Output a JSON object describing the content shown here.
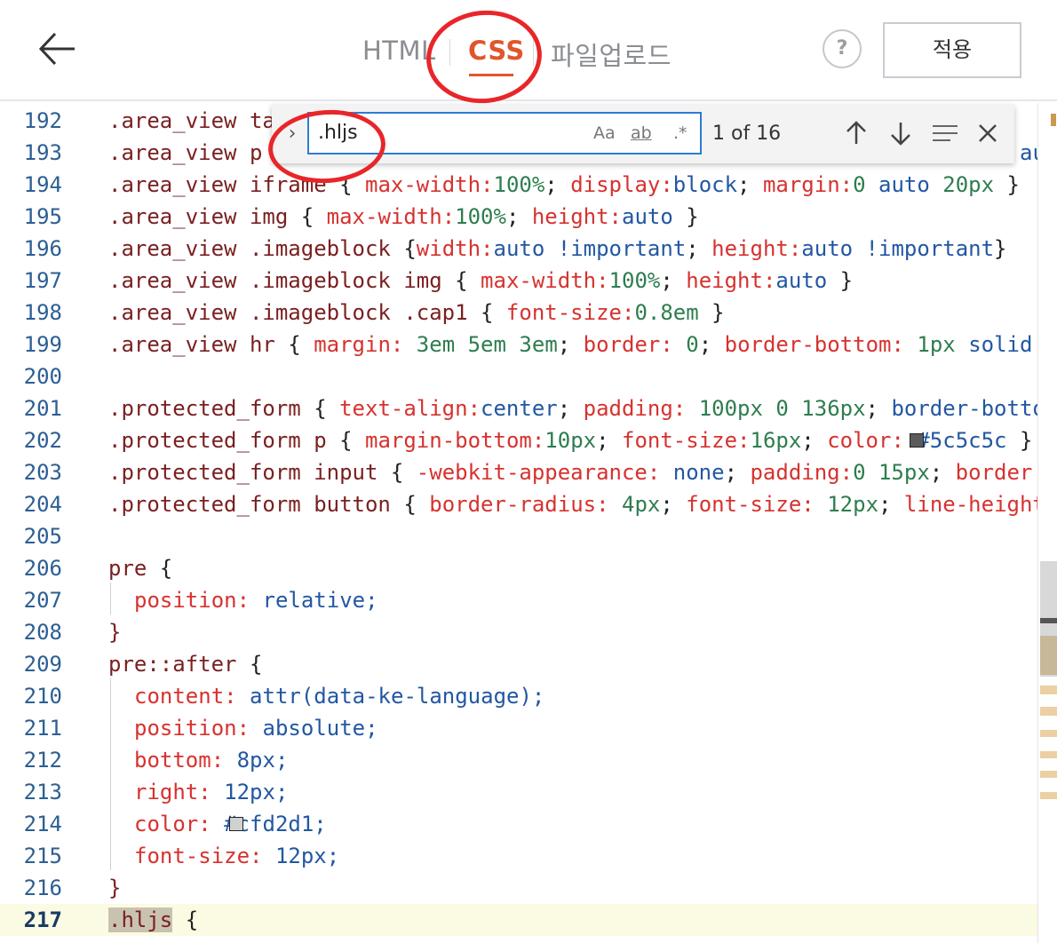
{
  "header": {
    "tabs": [
      {
        "label": "HTML"
      },
      {
        "label": "CSS"
      },
      {
        "label": "파일업로드"
      }
    ],
    "help_label": "?",
    "apply_label": "적용",
    "active_tab": "CSS",
    "accent_color": "#e0562c"
  },
  "find": {
    "query": ".hljs",
    "match_case_label": "Aa",
    "whole_word_label": "ab",
    "regex_label": ".*",
    "count": "1 of 16"
  },
  "lines": [
    {
      "n": "192",
      "text": ".area_view ta"
    },
    {
      "n": "193",
      "text": ".area_view p"
    },
    {
      "n": "194",
      "text": ".area_view iframe { max-width:100%; display:block; margin:0 auto 20px }"
    },
    {
      "n": "195",
      "text": ".area_view img { max-width:100%; height:auto }"
    },
    {
      "n": "196",
      "text": ".area_view .imageblock {width:auto !important; height:auto !important}"
    },
    {
      "n": "197",
      "text": ".area_view .imageblock img { max-width:100%; height:auto }"
    },
    {
      "n": "198",
      "text": ".area_view .imageblock .cap1 { font-size:0.8em }"
    },
    {
      "n": "199",
      "text": ".area_view hr { margin: 3em 5em 3em; border: 0; border-bottom: 1px solid"
    },
    {
      "n": "200",
      "text": ""
    },
    {
      "n": "201",
      "text": ".protected_form { text-align:center; padding: 100px 0 136px; border-bottom"
    },
    {
      "n": "202",
      "text": ".protected_form p { margin-bottom:10px; font-size:16px; color: #5c5c5c }"
    },
    {
      "n": "203",
      "text": ".protected_form input { -webkit-appearance: none; padding:0 15px; border:"
    },
    {
      "n": "204",
      "text": ".protected_form button { border-radius: 4px; font-size: 12px; line-height:"
    },
    {
      "n": "205",
      "text": ""
    },
    {
      "n": "206",
      "text": "pre {"
    },
    {
      "n": "207",
      "text": "position: relative;"
    },
    {
      "n": "208",
      "text": "}"
    },
    {
      "n": "209",
      "text": "pre::after {"
    },
    {
      "n": "210",
      "text": "content: attr(data-ke-language);"
    },
    {
      "n": "211",
      "text": "position: absolute;"
    },
    {
      "n": "212",
      "text": "bottom: 8px;"
    },
    {
      "n": "213",
      "text": "right: 12px;"
    },
    {
      "n": "214",
      "text": "color: #cfd2d1;"
    },
    {
      "n": "215",
      "text": "font-size: 12px;"
    },
    {
      "n": "216",
      "text": "}"
    },
    {
      "n": "217",
      "text": ".hljs {"
    }
  ],
  "fragments": {
    "l193_tail": "aut",
    "l199_swatch": "#5c5c5c",
    "l202_swatch": "#5c5c5c",
    "l214_swatch": "#cfd2d1"
  }
}
